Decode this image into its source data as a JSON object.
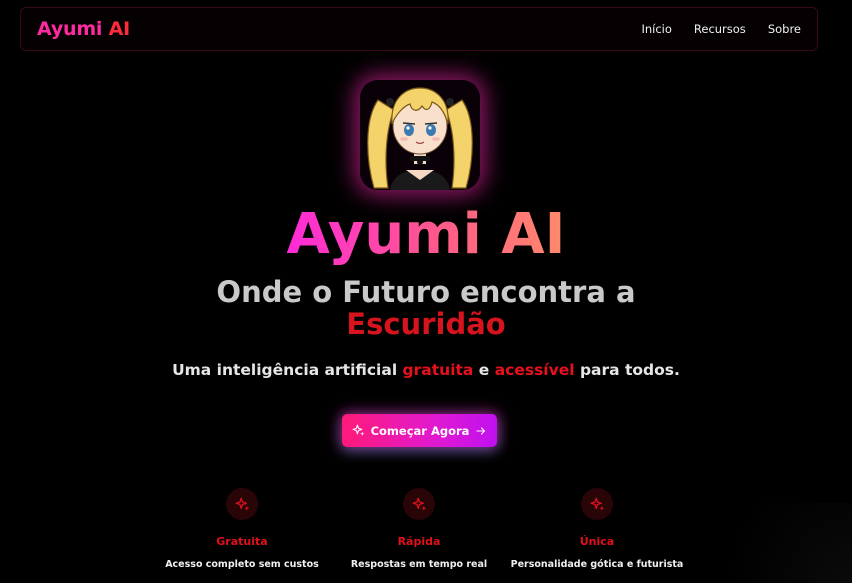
{
  "nav": {
    "brand_part1": "Ayumi",
    "brand_part2": "AI",
    "links": [
      "Início",
      "Recursos",
      "Sobre"
    ]
  },
  "hero": {
    "avatar_icon": "anime-girl-avatar",
    "title": "Ayumi AI",
    "subtitle_line1": "Onde o Futuro encontra a",
    "subtitle_line2": "Escuridão",
    "tagline": {
      "part1": "Uma inteligência artificial ",
      "highlight1": "gratuita",
      "part2": " e ",
      "highlight2": "acessível",
      "part3": " para todos."
    },
    "cta": {
      "label": "Começar Agora",
      "icon_left": "sparkles-icon",
      "icon_right": "arrow-right-icon"
    }
  },
  "features": [
    {
      "icon": "sparkles-icon",
      "title": "Gratuita",
      "description": "Acesso completo sem custos"
    },
    {
      "icon": "sparkles-icon",
      "title": "Rápida",
      "description": "Respostas em tempo real"
    },
    {
      "icon": "sparkles-icon",
      "title": "Única",
      "description": "Personalidade gótica e futurista"
    }
  ],
  "colors": {
    "background": "#000000",
    "accent_red": "#e0101c",
    "accent_pink": "#ff2aa0",
    "cta_gradient_start": "#ff1a78",
    "cta_gradient_end": "#c010f0"
  }
}
